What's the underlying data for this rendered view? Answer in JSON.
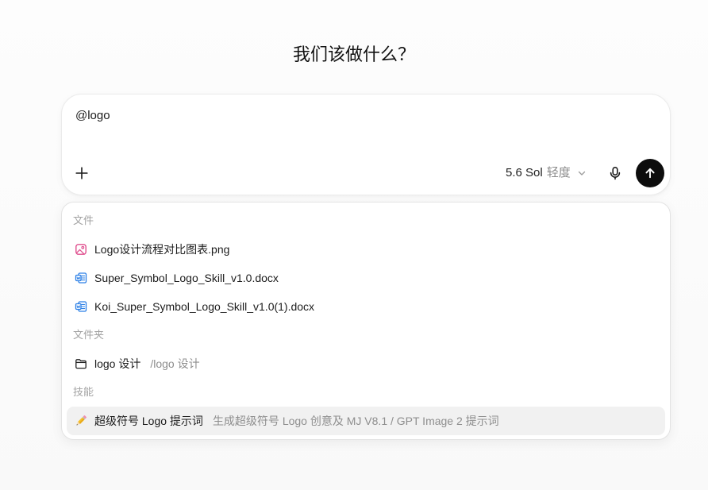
{
  "page": {
    "title": "我们该做什么？"
  },
  "composer": {
    "input_value": "@logo",
    "add_button_icon": "plus-icon",
    "model": {
      "name": "5.6 Sol",
      "effort": "轻度",
      "dropdown_icon": "chevron-down-icon"
    },
    "mic_button_icon": "microphone-icon",
    "send_button_icon": "arrow-up-icon"
  },
  "mention_menu": {
    "files": {
      "label": "文件",
      "items": [
        {
          "icon": "image-file-icon",
          "name": "Logo设计流程对比图表.png"
        },
        {
          "icon": "word-document-icon",
          "name": "Super_Symbol_Logo_Skill_v1.0.docx"
        },
        {
          "icon": "word-document-icon",
          "name": "Koi_Super_Symbol_Logo_Skill_v1.0(1).docx"
        }
      ]
    },
    "folders": {
      "label": "文件夹",
      "items": [
        {
          "icon": "folder-icon",
          "name": "logo 设计",
          "path": "/logo 设计"
        }
      ]
    },
    "skills": {
      "label": "技能",
      "items": [
        {
          "icon": "pencil-icon",
          "name": "超级符号 Logo 提示词",
          "description": "生成超级符号 Logo 创意及 MJ V8.1 / GPT Image 2 提示词",
          "highlighted": true
        }
      ]
    }
  },
  "colors": {
    "page_background": "#f9f9f9",
    "text_primary": "#1a1a1a",
    "text_secondary": "#8e8e8e",
    "section_label": "#a3a3a3",
    "send_button": "#0d0d0d",
    "highlight_row": "#f1f1f1",
    "image_icon": "#e0508f",
    "document_icon": "#2b7fe6"
  }
}
